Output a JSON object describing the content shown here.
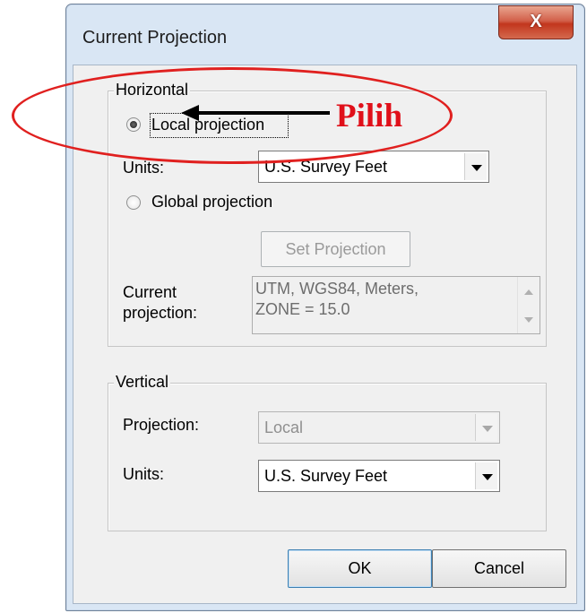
{
  "window": {
    "title": "Current Projection",
    "close_glyph": "X"
  },
  "horizontal": {
    "legend": "Horizontal",
    "local_projection_label": "Local projection",
    "local_selected": true,
    "units_label": "Units:",
    "units_value": "U.S. Survey Feet",
    "global_projection_label": "Global projection",
    "set_projection_label": "Set Projection",
    "current_projection_label_line1": "Current",
    "current_projection_label_line2": "projection:",
    "current_projection_line1": "UTM, WGS84, Meters,",
    "current_projection_line2": "ZONE = 15.0"
  },
  "vertical": {
    "legend": "Vertical",
    "projection_label": "Projection:",
    "projection_value": "Local",
    "units_label": "Units:",
    "units_value": "U.S. Survey Feet"
  },
  "buttons": {
    "ok": "OK",
    "cancel": "Cancel"
  },
  "annotation": {
    "text": "Pilih",
    "color": "#e0101a"
  },
  "icons": {
    "close": "close-icon",
    "dropdown": "chevron-down-icon",
    "scroll_up": "scroll-up-icon",
    "scroll_down": "scroll-down-icon"
  }
}
